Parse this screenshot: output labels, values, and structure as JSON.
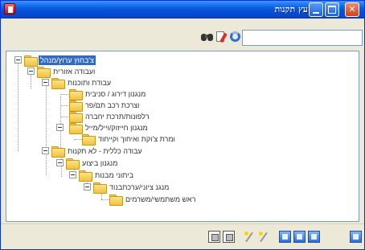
{
  "window": {
    "title": "עץ תקנות"
  },
  "search": {
    "value": "",
    "placeholder": ""
  },
  "tree": {
    "nodes": [
      {
        "label": "צ'ּבחוץ ערוץ/מנהל",
        "selected": true
      },
      {
        "label": "ועבודה אזורית",
        "selected": false
      },
      {
        "label": "עבודת ותוכנות",
        "selected": false
      },
      {
        "label": "מנגנון דירוג / סניבית",
        "selected": false
      },
      {
        "label": "וצרכת רכב תם/פר",
        "selected": false
      },
      {
        "label": "רלפונות/תרכת יחברה",
        "selected": false
      },
      {
        "label": "מנגנון חייזוק/וייל/מייל",
        "selected": false
      },
      {
        "label": "ומרת צ'וקת ואיחוך וקייחוד",
        "selected": false
      },
      {
        "label": "עבודה כללית - לא תקנות",
        "selected": false
      },
      {
        "label": "מנגנון ביצוע",
        "selected": false
      },
      {
        "label": "ביתוני מבנות",
        "selected": false
      },
      {
        "label": "מנגנ ציוני/ערכתבנוד",
        "selected": false
      },
      {
        "label": "ראש משתמשי/משרמים",
        "selected": false
      }
    ]
  },
  "icons": {
    "title_app": "app-icon",
    "minimize": "minimize-icon",
    "maximize": "maximize-icon",
    "close": "close-icon",
    "find": "binoculars-icon",
    "properties": "properties-icon",
    "refresh": "refresh-icon"
  },
  "bottom_toolbar": {
    "icons": [
      "view-icon",
      "grid-icon",
      "wand-icon",
      "wand-alt-icon",
      "window-blue-icon",
      "window-new-icon",
      "window-edit-icon",
      "window-exit-icon"
    ]
  },
  "colors": {
    "titlebar": "#0a5fe0",
    "selection": "#316ac5",
    "folder": "#f0c23e"
  }
}
